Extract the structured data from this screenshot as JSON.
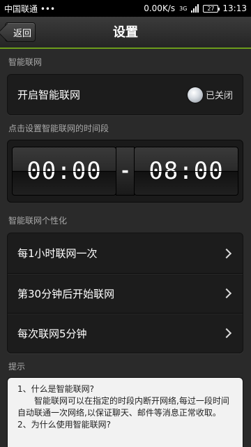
{
  "status_bar": {
    "carrier": "中国联通 •••",
    "speed": "0.00K/s",
    "network": "3G",
    "battery": "27",
    "time": "13:13"
  },
  "header": {
    "back_label": "返回",
    "title": "设置"
  },
  "smart_network": {
    "section_title": "智能联网",
    "toggle_label": "开启智能联网",
    "toggle_state": "已关闭"
  },
  "time_period": {
    "section_title": "点击设置智能联网的时间段",
    "start": "00:00",
    "separator": "-",
    "end": "08:00"
  },
  "personalize": {
    "section_title": "智能联网个性化",
    "items": [
      {
        "label": "每1小时联网一次"
      },
      {
        "label": "第30分钟后开始联网"
      },
      {
        "label": "每次联网5分钟"
      }
    ]
  },
  "tips": {
    "section_title": "提示",
    "q1": "1、什么是智能联网?",
    "a1": "智能联网可以在指定的时段内断开网络,每过一段时间自动联通一次网络,以保证聊天、邮件等消息正常收取。",
    "q2": "2、为什么使用智能联网?"
  }
}
